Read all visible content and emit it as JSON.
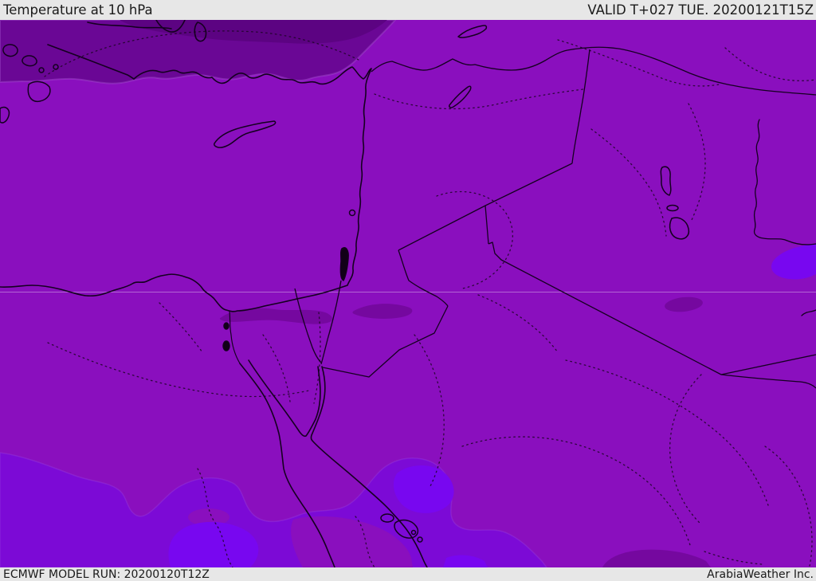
{
  "header": {
    "title": "Temperature at 10 hPa",
    "valid": "VALID T+027 TUE. 20200121T15Z"
  },
  "footer": {
    "model_run": "ECMWF MODEL RUN: 20200120T12Z",
    "brand": "ArabiaWeather Inc."
  },
  "colors": {
    "bar_bg": "#e7e7e7",
    "bar_text": "#1a1a1a",
    "shade_main": "#8A0FBE",
    "shade_dark_band": "#6A0795",
    "shade_darkest": "#5C0382",
    "shade_dark_blob": "#75089F",
    "shade_vivid": "#7C0AD6",
    "shade_bright": "#7807F0",
    "water_fill": "#120018",
    "line": "#150020",
    "dotted_line": "#1d0526",
    "graticule": "#e3cdf2"
  }
}
